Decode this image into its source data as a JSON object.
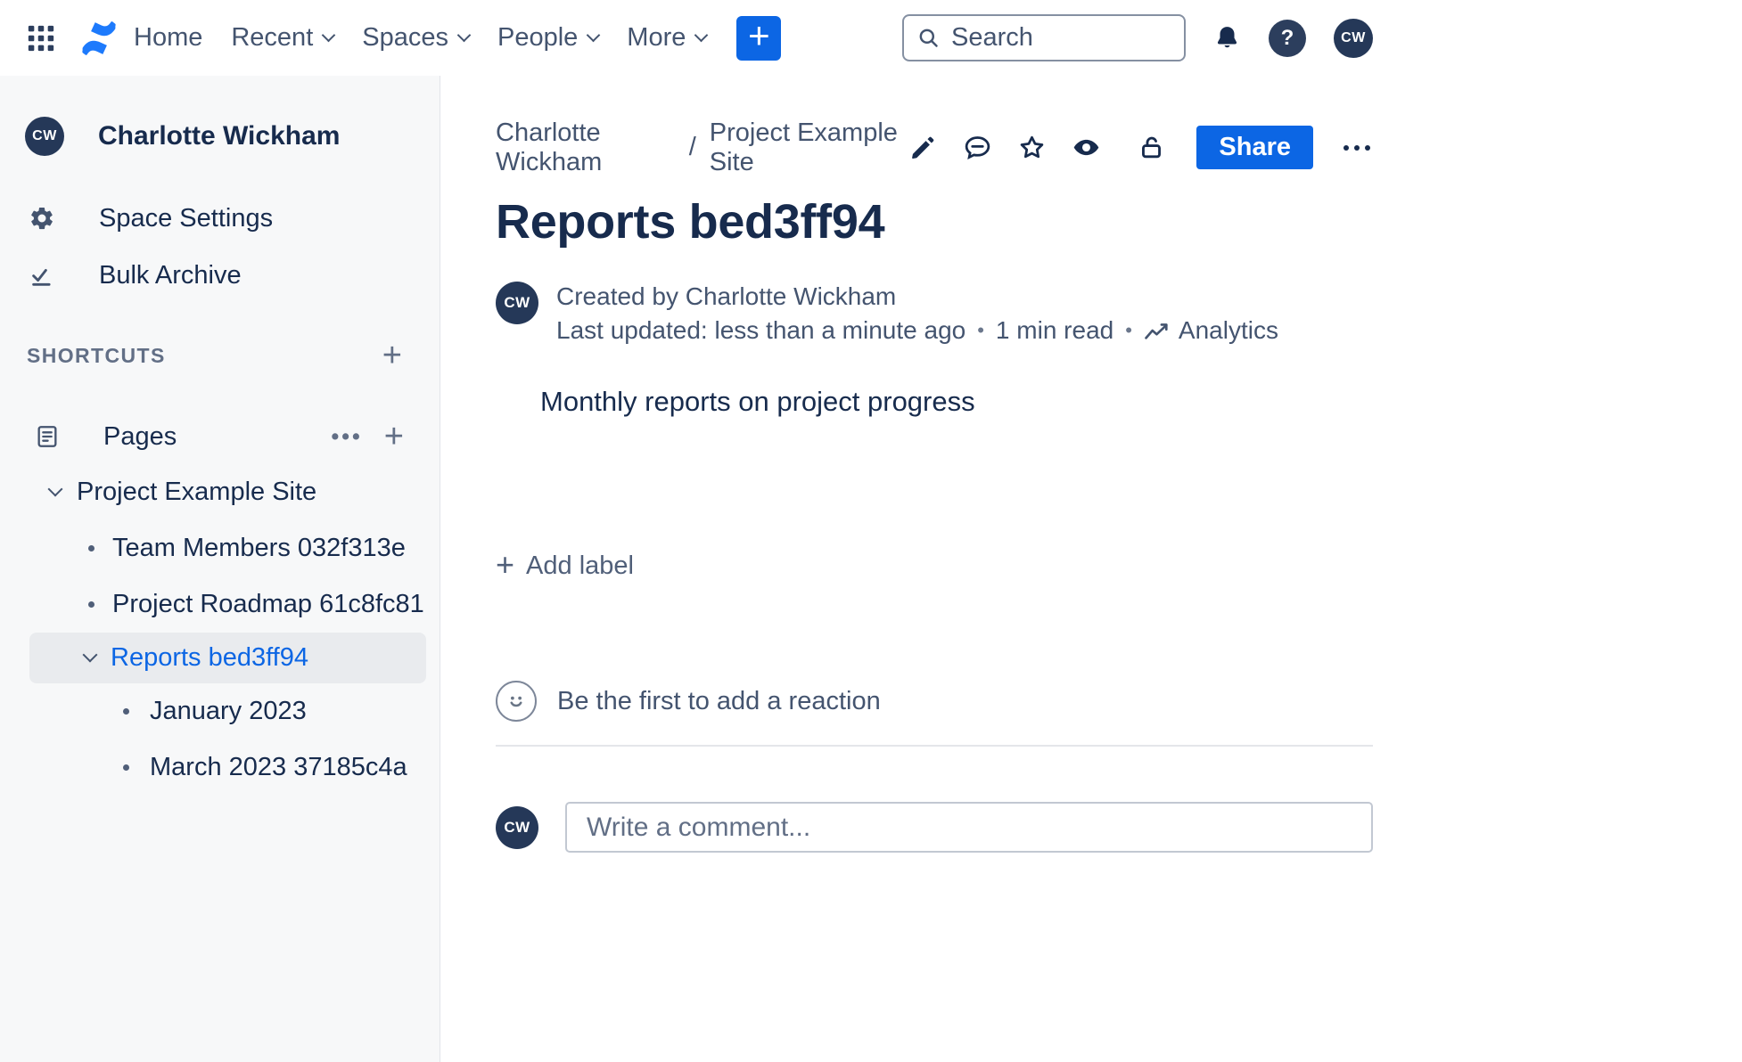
{
  "topbar": {
    "nav": [
      {
        "label": "Home"
      },
      {
        "label": "Recent"
      },
      {
        "label": "Spaces"
      },
      {
        "label": "People"
      },
      {
        "label": "More"
      }
    ],
    "create_button": "+",
    "search": {
      "placeholder": "Search"
    },
    "help_glyph": "?",
    "user_initials": "CW"
  },
  "sidebar": {
    "user": {
      "initials": "CW",
      "name": "Charlotte Wickham"
    },
    "menu": [
      {
        "label": "Space Settings"
      },
      {
        "label": "Bulk Archive"
      }
    ],
    "shortcuts": {
      "label": "SHORTCUTS",
      "add": "+"
    },
    "pages": {
      "label": "Pages",
      "more": "•••",
      "add": "+"
    },
    "tree": {
      "root": "Project Example Site",
      "children": [
        "Team Members 032f313e",
        "Project Roadmap 61c8fc81"
      ],
      "selected": "Reports bed3ff94",
      "selected_children": [
        "January 2023",
        "March 2023 37185c4a"
      ]
    }
  },
  "content": {
    "breadcrumb": {
      "items": [
        "Charlotte Wickham",
        "Project Example Site"
      ],
      "separator": "/"
    },
    "actions": {
      "share": "Share"
    },
    "title": "Reports bed3ff94",
    "byline": {
      "initials": "CW",
      "created": "Created by Charlotte Wickham",
      "updated": "Last updated: less than a minute ago",
      "separator": "•",
      "read_time": "1 min read",
      "analytics": "Analytics"
    },
    "body_text": "Monthly reports on project progress",
    "add_label": {
      "plus": "+",
      "label": "Add label"
    },
    "reactions": {
      "prompt": "Be the first to add a reaction"
    },
    "comment": {
      "initials": "CW",
      "placeholder": "Write a comment..."
    }
  },
  "colors": {
    "brand_blue": "#1D7AFC",
    "button_blue": "#0C66E4",
    "selected_blue": "#0C66E4",
    "text_primary": "#172B4D",
    "text_muted": "#44546F",
    "avatar_bg": "#253858",
    "sidebar_bg": "#F7F8F9",
    "selected_bg": "#E9EBEE"
  }
}
